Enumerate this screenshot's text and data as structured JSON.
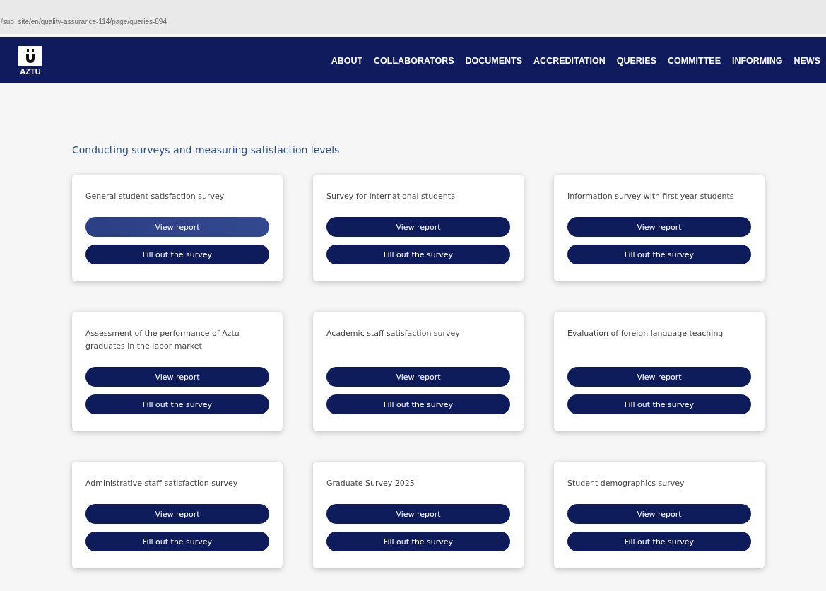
{
  "address_bar": {
    "url": "/sub_site/en/quality-assurance-114/page/queries-894"
  },
  "header": {
    "logo_text": "AZTU",
    "nav": [
      "ABOUT",
      "COLLABORATORS",
      "DOCUMENTS",
      "ACCREDITATION",
      "QUERIES",
      "COMMITTEE",
      "INFORMING",
      "NEWS"
    ]
  },
  "heading": "Conducting surveys and measuring satisfaction levels",
  "cards": [
    {
      "title": "General student satisfaction survey",
      "buttons": [
        {
          "label": "View report",
          "highlighted": true
        },
        {
          "label": "Fill out the survey",
          "highlighted": false
        }
      ]
    },
    {
      "title": "Survey for International students",
      "buttons": [
        {
          "label": "View report",
          "highlighted": false
        },
        {
          "label": "Fill out the survey",
          "highlighted": false
        }
      ]
    },
    {
      "title": "Information survey with first-year students",
      "buttons": [
        {
          "label": "View report",
          "highlighted": false
        },
        {
          "label": "Fill out the survey",
          "highlighted": false
        }
      ]
    },
    {
      "title": "Assessment of the performance of Aztu graduates in the labor market",
      "buttons": [
        {
          "label": "View report",
          "highlighted": false
        },
        {
          "label": "Fill out the survey",
          "highlighted": false
        }
      ]
    },
    {
      "title": "Academic staff satisfaction survey",
      "buttons": [
        {
          "label": "View report",
          "highlighted": false
        },
        {
          "label": "Fill out the survey",
          "highlighted": false
        }
      ]
    },
    {
      "title": "Evaluation of foreign language teaching",
      "buttons": [
        {
          "label": "View report",
          "highlighted": false
        },
        {
          "label": "Fill out the survey",
          "highlighted": false
        }
      ]
    },
    {
      "title": "Administrative staff satisfaction survey",
      "buttons": [
        {
          "label": "View report",
          "highlighted": false
        },
        {
          "label": "Fill out the survey",
          "highlighted": false
        }
      ]
    },
    {
      "title": "Graduate Survey 2025",
      "buttons": [
        {
          "label": "View report",
          "highlighted": false
        },
        {
          "label": "Fill out the survey",
          "highlighted": false
        }
      ]
    },
    {
      "title": "Student demographics survey",
      "buttons": [
        {
          "label": "View report",
          "highlighted": false
        },
        {
          "label": "Fill out the survey",
          "highlighted": false
        }
      ]
    }
  ]
}
